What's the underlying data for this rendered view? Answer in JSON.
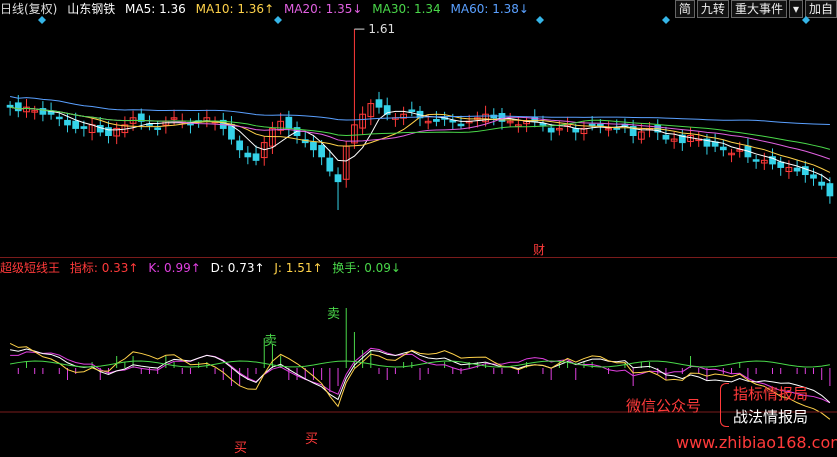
{
  "header": {
    "period": "日线(复权)",
    "stock": "山东钢铁",
    "ma5": "MA5: 1.36",
    "ma10": "MA10: 1.36↑",
    "ma20": "MA20: 1.35↓",
    "ma30": "MA30: 1.34",
    "ma60": "MA60: 1.38↓"
  },
  "toolbar": {
    "simple": "简",
    "nine": "九转",
    "events": "重大事件",
    "dropdown": "▾",
    "add": "加自"
  },
  "indicator": {
    "name": "超级短线王",
    "index": "指标: 0.33↑",
    "k": "K: 0.99↑",
    "d": "D: 0.73↑",
    "j": "J: 1.51↑",
    "turnover": "换手: 0.09↓"
  },
  "colors": {
    "bull": "#ff3a3a",
    "bear": "#35d2e8",
    "ma5": "#ffffff",
    "ma10": "#ffd24a",
    "ma20": "#e060e0",
    "ma30": "#4ad84a",
    "ma60": "#5aa0ff",
    "k": "#e040e0",
    "d": "#ffffff",
    "j": "#ffd24a"
  },
  "chart_data": {
    "type": "line",
    "high_marker": "1.61",
    "finance_marker": "财",
    "signals": [
      {
        "label": "卖",
        "kind": "sell"
      },
      {
        "label": "卖",
        "kind": "sell"
      },
      {
        "label": "买",
        "kind": "buy"
      },
      {
        "label": "买",
        "kind": "buy"
      }
    ],
    "closes": [
      1.39,
      1.38,
      1.39,
      1.38,
      1.37,
      1.37,
      1.36,
      1.34,
      1.33,
      1.33,
      1.34,
      1.32,
      1.31,
      1.33,
      1.34,
      1.36,
      1.35,
      1.34,
      1.33,
      1.35,
      1.36,
      1.35,
      1.34,
      1.35,
      1.36,
      1.35,
      1.33,
      1.3,
      1.27,
      1.25,
      1.24,
      1.29,
      1.33,
      1.35,
      1.33,
      1.31,
      1.29,
      1.27,
      1.25,
      1.21,
      1.18,
      1.28,
      1.34,
      1.37,
      1.4,
      1.39,
      1.37,
      1.36,
      1.37,
      1.38,
      1.36,
      1.35,
      1.35,
      1.36,
      1.35,
      1.34,
      1.35,
      1.36,
      1.37,
      1.36,
      1.35,
      1.35,
      1.34,
      1.35,
      1.35,
      1.34,
      1.32,
      1.33,
      1.34,
      1.32,
      1.33,
      1.34,
      1.34,
      1.33,
      1.33,
      1.34,
      1.31,
      1.32,
      1.33,
      1.32,
      1.3,
      1.3,
      1.29,
      1.31,
      1.3,
      1.28,
      1.28,
      1.27,
      1.26,
      1.27,
      1.25,
      1.24,
      1.24,
      1.23,
      1.22,
      1.22,
      1.21,
      1.2,
      1.19,
      1.17,
      1.14
    ],
    "highs_note": "max 1.61",
    "ylim": [
      1.1,
      1.63
    ]
  },
  "watermark": {
    "wechat": "微信公众号",
    "line1": "指标情报局",
    "line2": "战法情报局",
    "site": "www.zhibiao168.com"
  }
}
